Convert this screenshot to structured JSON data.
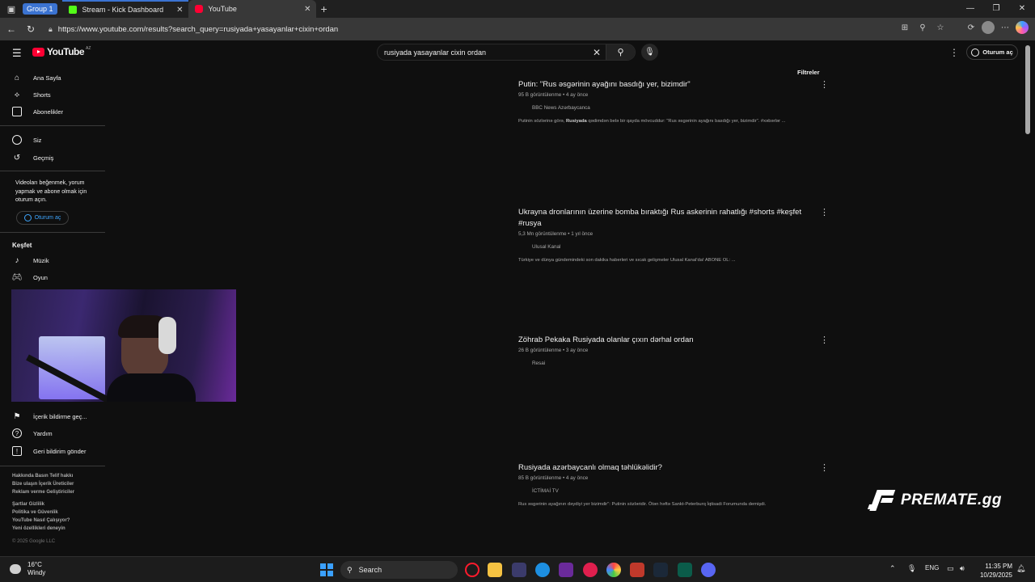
{
  "browser": {
    "tab_group_label": "Group 1",
    "tabs": [
      {
        "label": "Stream - Kick Dashboard"
      },
      {
        "label": "YouTube"
      }
    ],
    "url": "https://www.youtube.com/results?search_query=rusiyada+yasayanlar+cixin+ordan"
  },
  "youtube": {
    "logo_text": "YouTube",
    "region_code": "AZ",
    "search_query": "rusiyada yasayanlar cixin ordan",
    "signin_label": "Oturum aç",
    "filters_label": "Filtreler"
  },
  "sidebar": {
    "primary": [
      {
        "label": "Ana Sayfa",
        "icon": "home-icon"
      },
      {
        "label": "Shorts",
        "icon": "shorts-icon"
      },
      {
        "label": "Abonelikler",
        "icon": "subscriptions-icon"
      }
    ],
    "you": [
      {
        "label": "Siz",
        "icon": "user-circle-icon"
      },
      {
        "label": "Geçmiş",
        "icon": "history-icon"
      }
    ],
    "signin_note": "Videoları beğenmek, yorum yapmak ve abone olmak için oturum açın.",
    "signin_label": "Oturum aç",
    "explore_heading": "Keşfet",
    "explore": [
      {
        "label": "Müzik",
        "icon": "music-note-icon"
      },
      {
        "label": "Oyun",
        "icon": "gaming-icon"
      }
    ],
    "more": [
      {
        "label": "İçerik bildirme geç...",
        "icon": "flag-icon"
      },
      {
        "label": "Yardım",
        "icon": "help-icon"
      },
      {
        "label": "Geri bildirim gönder",
        "icon": "feedback-icon"
      }
    ],
    "footer_rows": [
      "Hakkında  Basın  Telif hakkı",
      "Bize ulaşın  İçerik Üreticiler",
      "Reklam verme  Geliştiriciler",
      "",
      "Şartlar  Gizlilik",
      "Politika ve Güvenlik",
      "YouTube Nasıl Çalışıyor?",
      "Yeni özellikleri deneyin"
    ],
    "copyright": "© 2025 Google LLC"
  },
  "results": [
    {
      "title": "Putin: \"Rus əsgərinin ayağını basdığı yer, bizimdir\"",
      "meta": "95 B görüntülenme • 4 ay önce",
      "channel": "BBC News Azərbaycanca",
      "desc_pre": "Putinin sözlərinə görə, ",
      "desc_bold": "Rusiyada",
      "desc_post": " qədimdən belə bir qayda mövcuddur: \"Rus əsgərinin ayağını basdığı yer, bizimdir\". #xəbərlər ..."
    },
    {
      "title": "Ukrayna dronlarının üzerine bomba bıraktığı Rus askerinin rahatlığı #shorts #keşfet #rusya",
      "meta": "5,3 Mn görüntülenme • 1 yıl önce",
      "channel": "Ulusal Kanal",
      "desc_pre": "Türkiye ve dünya gündemindeki son dakika haberleri ve sıcak gelişmeler Ulusal Kanal'da! ABONE OL: ...",
      "desc_bold": "",
      "desc_post": ""
    },
    {
      "title": "Zöhrab Pekaka Rusiyada olanlar çıxın dərhal ordan",
      "meta": "26 B görüntülenme • 3 ay önce",
      "channel": "Resai",
      "desc_pre": "",
      "desc_bold": "",
      "desc_post": ""
    },
    {
      "title": "Rusiyada azərbaycanlı olmaq təhlükəlidir?",
      "meta": "85 B görüntülenme • 4 ay önce",
      "channel": "İCTİMAİ TV",
      "desc_pre": "Rus əsgərinin ayağının dəydiyi yer bizimdir\": Putinin sözləridir. Ötən həftə Sankt-Peterburq İqtisadi Forumunda demişdi.",
      "desc_bold": "",
      "desc_post": ""
    }
  ],
  "overlay": {
    "brand": "PREMATE.gg"
  },
  "taskbar": {
    "temperature": "16°C",
    "weather": "Windy",
    "search_label": "Search",
    "language": "ENG",
    "time": "11:35 PM",
    "date": "10/29/2025"
  }
}
